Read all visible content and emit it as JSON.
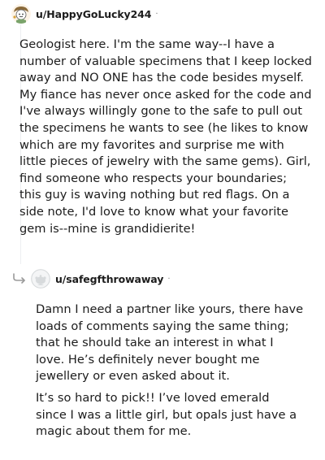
{
  "comments": [
    {
      "username": "u/HappyGoLucky244",
      "separator": "·",
      "avatar_icon": "snoo-avatar-happygolucky-icon",
      "body": [
        "Geologist here. I'm the same way--I have a number of valuable specimens that I keep locked away and NO ONE has the code besides myself. My fiance has never once asked for the code and I've always willingly gone to the safe to pull out the specimens he wants to see (he likes to know which are my favorites and surprise me with little pieces of jewelry with the same gems). Girl, find someone who respects your boundaries; this guy is waving nothing but red flags. On a side note, I'd love to know what your favorite gem is--mine is grandidierite!"
      ]
    },
    {
      "username": "u/safegfthrowaway",
      "separator": "·",
      "avatar_icon": "default-snoo-avatar-icon",
      "reply_icon": "reply-arrow-icon",
      "body": [
        "Damn I need a partner like yours, there have loads of comments saying the same thing; that he should take an interest in what I love. He’s definitely never bought me jewellery or even asked about it.",
        "It’s so hard to pick!! I’ve loved emerald since I was a little girl, but opals just have a magic about them for me."
      ]
    }
  ],
  "colors": {
    "text": "#1c1c1c",
    "meta": "#7c7c7c",
    "avatar2_bg": "#d7dadc"
  }
}
